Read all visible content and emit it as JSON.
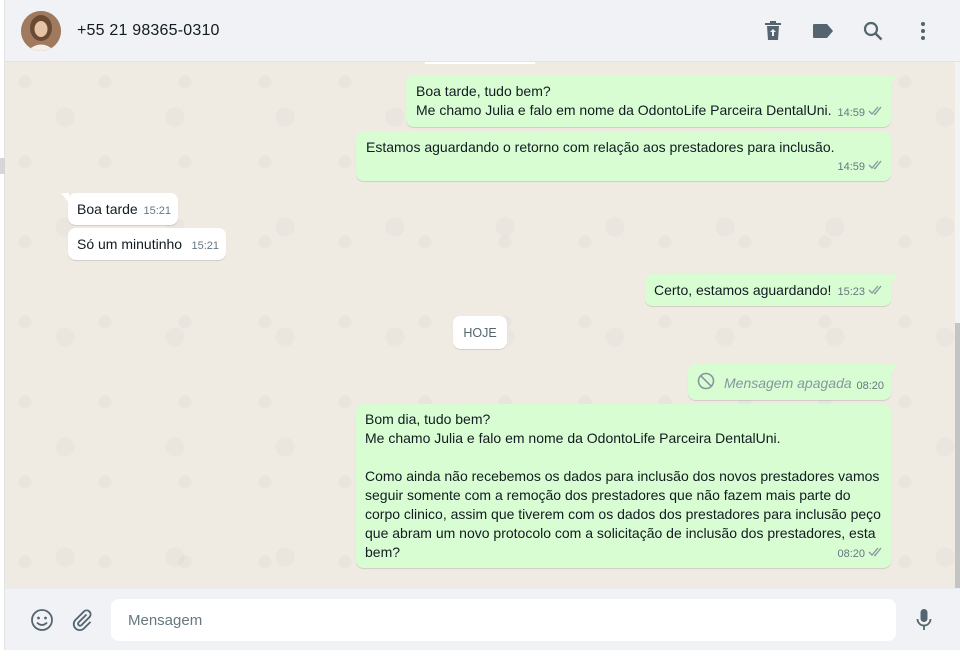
{
  "header": {
    "contact_name": "+55 21 98365-0310",
    "actions": [
      {
        "name": "trash-icon"
      },
      {
        "name": "label-icon"
      },
      {
        "name": "search-icon"
      },
      {
        "name": "more-icon"
      }
    ]
  },
  "colors": {
    "outgoing_bubble": "#d9fdd3",
    "incoming_bubble": "#ffffff",
    "chat_background": "#efeae2",
    "panel": "#f0f2f5",
    "meta_text": "#667781",
    "read_ticks": "#8696a0"
  },
  "messages": [
    {
      "direction": "out",
      "text": "Boa tarde, tudo bem?\nMe chamo Julia e falo em nome da OdontoLife Parceira DentalUni.",
      "time": "14:59",
      "status": "read"
    },
    {
      "direction": "out",
      "text": "Estamos aguardando o retorno com relação aos prestadores para inclusão.",
      "time": "14:59",
      "status": "read"
    },
    {
      "direction": "in",
      "text": "Boa tarde",
      "time": "15:21"
    },
    {
      "direction": "in",
      "text": "Só um minutinho",
      "time": "15:21"
    },
    {
      "direction": "out",
      "text": "Certo, estamos aguardando!",
      "time": "15:23",
      "status": "read"
    },
    {
      "direction": "out",
      "text": "Mensagem apagada",
      "time": "08:20",
      "deleted": true
    },
    {
      "direction": "out",
      "text": "Bom dia, tudo bem?\nMe chamo Julia e falo em nome da OdontoLife Parceira DentalUni.\n\nComo ainda não recebemos os dados para inclusão dos novos prestadores vamos seguir somente com a remoção dos prestadores que não fazem mais parte do corpo clinico, assim que tiverem com os dados dos prestadores para inclusão peço que abram um novo protocolo com a solicitação de inclusão dos prestadores, esta bem?",
      "time": "08:20",
      "status": "read"
    }
  ],
  "date_divider": "HOJE",
  "composer": {
    "placeholder": "Mensagem",
    "value": ""
  }
}
